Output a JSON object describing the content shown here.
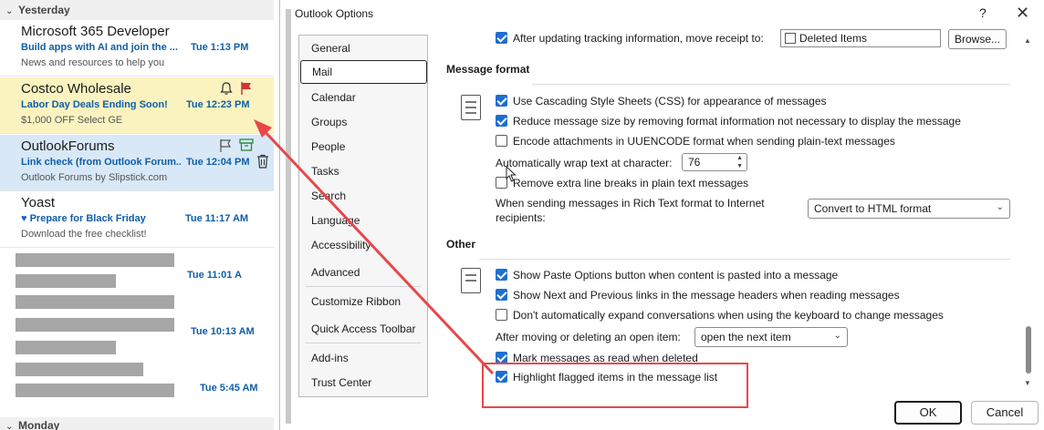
{
  "mail_list": {
    "groups": [
      {
        "label": "Yesterday"
      },
      {
        "label": "Monday"
      }
    ],
    "items": [
      {
        "sender": "Microsoft 365 Developer",
        "subject": "Build apps with AI and join the ...",
        "time": "Tue 1:13 PM",
        "preview": "News and resources to help you"
      },
      {
        "sender": "Costco Wholesale",
        "subject": "Labor Day Deals Ending Soon!",
        "time": "Tue 12:23 PM",
        "preview": "$1,000 OFF Select GE"
      },
      {
        "sender": "OutlookForums",
        "subject": "Link check (from Outlook Forum...",
        "time": "Tue 12:04 PM",
        "preview": "Outlook Forums by Slipstick.com"
      },
      {
        "sender": "Yoast",
        "subject": "Prepare for Black Friday",
        "time": "Tue 11:17 AM",
        "preview": "Download the free checklist!"
      },
      {
        "time": "Tue 11:01 A"
      },
      {
        "time": "Tue 10:13 AM"
      },
      {
        "time": "Tue 5:45 AM"
      }
    ]
  },
  "dialog": {
    "title": "Outlook Options",
    "help_label": "?",
    "close_label": "✕",
    "categories": [
      "General",
      "Mail",
      "Calendar",
      "Groups",
      "People",
      "Tasks",
      "Search",
      "Language",
      "Accessibility",
      "Advanced",
      "Customize Ribbon",
      "Quick Access Toolbar",
      "Add-ins",
      "Trust Center"
    ],
    "active_category": "Mail",
    "tracking": {
      "label": "After updating tracking information, move receipt to:",
      "checked": true,
      "folder": "Deleted Items",
      "browse_label": "Browse..."
    },
    "message_format": {
      "title": "Message format",
      "options": [
        {
          "label": "Use Cascading Style Sheets (CSS) for appearance of messages",
          "checked": true
        },
        {
          "label": "Reduce message size by removing format information not necessary to display the message",
          "checked": true
        },
        {
          "label": "Encode attachments in UUENCODE format when sending plain-text messages",
          "checked": false
        }
      ],
      "wrap_label": "Automatically wrap text at character:",
      "wrap_value": "76",
      "remove_breaks": {
        "label": "Remove extra line breaks in plain text messages",
        "checked": false
      },
      "rich_text_label_line1": "When sending messages in Rich Text format to Internet",
      "rich_text_label_line2": "recipients:",
      "rich_text_value": "Convert to HTML format"
    },
    "other": {
      "title": "Other",
      "options": [
        {
          "label": "Show Paste Options button when content is pasted into a message",
          "checked": true
        },
        {
          "label": "Show Next and Previous links in the message headers when reading messages",
          "checked": true
        },
        {
          "label": "Don't automatically expand conversations when using the keyboard to change messages",
          "checked": false
        }
      ],
      "after_moving_label": "After moving or deleting an open item:",
      "after_moving_value": "open the next item",
      "mark_read": {
        "label": "Mark messages as read when deleted",
        "checked": true
      },
      "highlight_flagged": {
        "label": "Highlight flagged items in the message list",
        "checked": true
      }
    },
    "ok_label": "OK",
    "cancel_label": "Cancel"
  },
  "colors": {
    "accent": "#1f6fcf",
    "annotation": "#e8474a",
    "flag_red": "#d13438",
    "flag_green": "#2b8a3e"
  }
}
